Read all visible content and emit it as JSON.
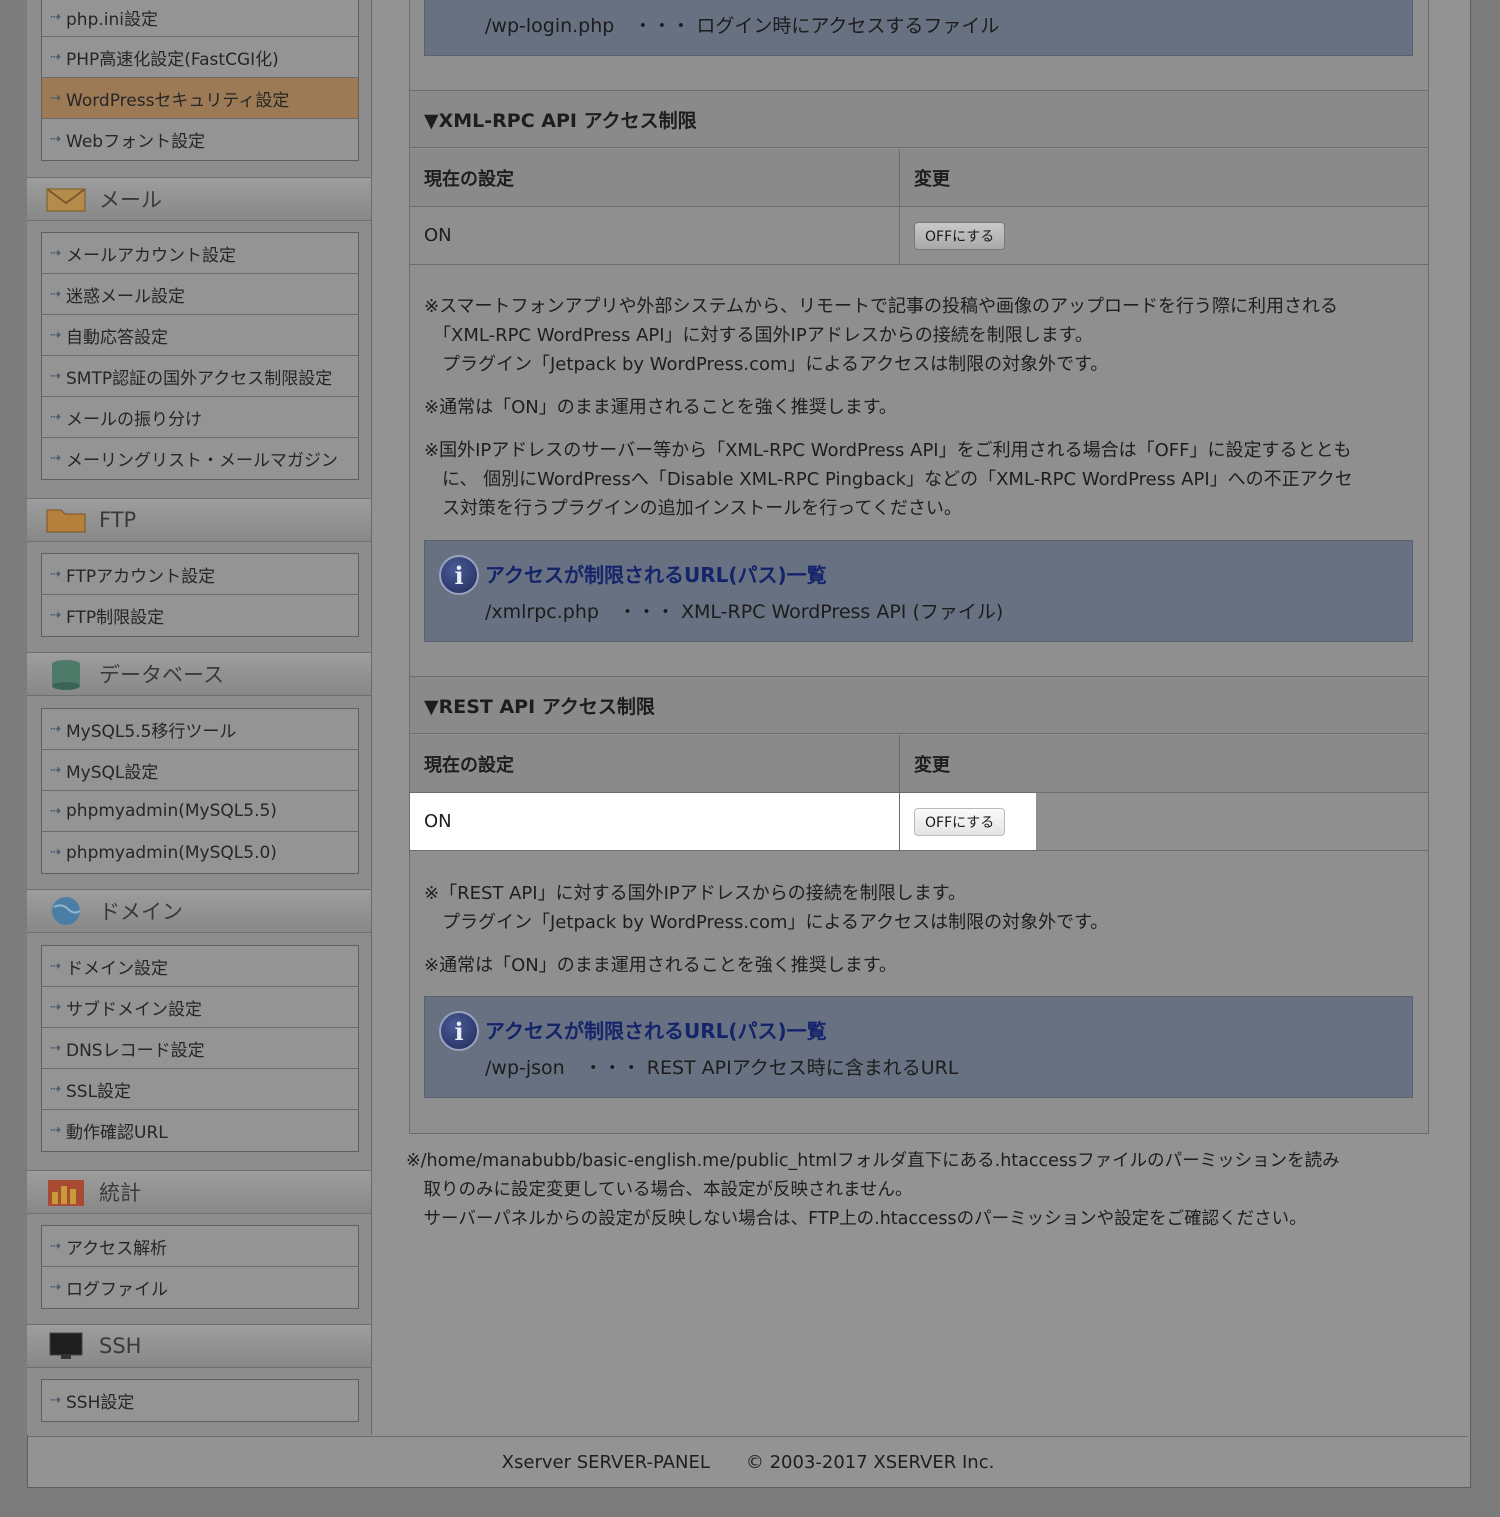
{
  "sidebar": {
    "server_group": [
      {
        "label": "php.ini設定"
      },
      {
        "label": "PHP高速化設定(FastCGI化)"
      },
      {
        "label": "WordPressセキュリティ設定"
      },
      {
        "label": "Webフォント設定"
      }
    ],
    "mail_header": "メール",
    "mail_group": [
      {
        "label": "メールアカウント設定"
      },
      {
        "label": "迷惑メール設定"
      },
      {
        "label": "自動応答設定"
      },
      {
        "label": "SMTP認証の国外アクセス制限設定"
      },
      {
        "label": "メールの振り分け"
      },
      {
        "label": "メーリングリスト・メールマガジン"
      }
    ],
    "ftp_header": "FTP",
    "ftp_group": [
      {
        "label": "FTPアカウント設定"
      },
      {
        "label": "FTP制限設定"
      }
    ],
    "db_header": "データベース",
    "db_group": [
      {
        "label": "MySQL5.5移行ツール"
      },
      {
        "label": "MySQL設定"
      },
      {
        "label": "phpmyadmin(MySQL5.5)"
      },
      {
        "label": "phpmyadmin(MySQL5.0)"
      }
    ],
    "domain_header": "ドメイン",
    "domain_group": [
      {
        "label": "ドメイン設定"
      },
      {
        "label": "サブドメイン設定"
      },
      {
        "label": "DNSレコード設定"
      },
      {
        "label": "SSL設定"
      },
      {
        "label": "動作確認URL"
      }
    ],
    "stats_header": "統計",
    "stats_group": [
      {
        "label": "アクセス解析"
      },
      {
        "label": "ログファイル"
      }
    ],
    "ssh_header": "SSH",
    "ssh_group": [
      {
        "label": "SSH設定"
      }
    ]
  },
  "top_info": {
    "path_line": "/wp-login.php　・・・ ログイン時にアクセスするファイル"
  },
  "xmlrpc": {
    "title": "▼XML-RPC API アクセス制限",
    "col_current": "現在の設定",
    "col_change": "変更",
    "current_value": "ON",
    "button_label": "OFFにする",
    "note1": "※スマートフォンアプリや外部システムから、リモートで記事の投稿や画像のアップロードを行う際に利用される\n　「XML-RPC WordPress API」に対する国外IPアドレスからの接続を制限します。\n　プラグイン「Jetpack by WordPress.com」によるアクセスは制限の対象外です。",
    "note2": "※通常は「ON」のまま運用されることを強く推奨します。",
    "note3": "※国外IPアドレスのサーバー等から「XML-RPC WordPress API」をご利用される場合は「OFF」に設定するととも\n　に、 個別にWordPressへ「Disable XML-RPC Pingback」などの「XML-RPC WordPress API」への不正アクセ\n　ス対策を行うプラグインの追加インストールを行ってください。",
    "info_title": "アクセスが制限されるURL(パス)一覧",
    "info_path": "/xmlrpc.php　・・・ XML-RPC WordPress API (ファイル)"
  },
  "rest": {
    "title": "▼REST API アクセス制限",
    "col_current": "現在の設定",
    "col_change": "変更",
    "current_value": "ON",
    "button_label": "OFFにする",
    "note1": "※「REST API」に対する国外IPアドレスからの接続を制限します。\n　プラグイン「Jetpack by WordPress.com」によるアクセスは制限の対象外です。",
    "note2": "※通常は「ON」のまま運用されることを強く推奨します。",
    "info_title": "アクセスが制限されるURL(パス)一覧",
    "info_path": "/wp-json　・・・ REST APIアクセス時に含まれるURL"
  },
  "bottom_note": "※/home/manabubb/basic-english.me/public_htmlフォルダ直下にある.htaccessファイルのパーミッションを読み\n　取りのみに設定変更している場合、本設定が反映されません。\n　サーバーパネルからの設定が反映しない場合は、FTP上の.htaccessのパーミッションや設定をご確認ください。",
  "footer": {
    "product": "Xserver SERVER-PANEL",
    "copyright": "© 2003-2017 XSERVER Inc."
  },
  "colors": {
    "active_menu": "#9c7a55",
    "info_box": "#687181",
    "info_title": "#13246a",
    "highlight": "#ffffff"
  }
}
